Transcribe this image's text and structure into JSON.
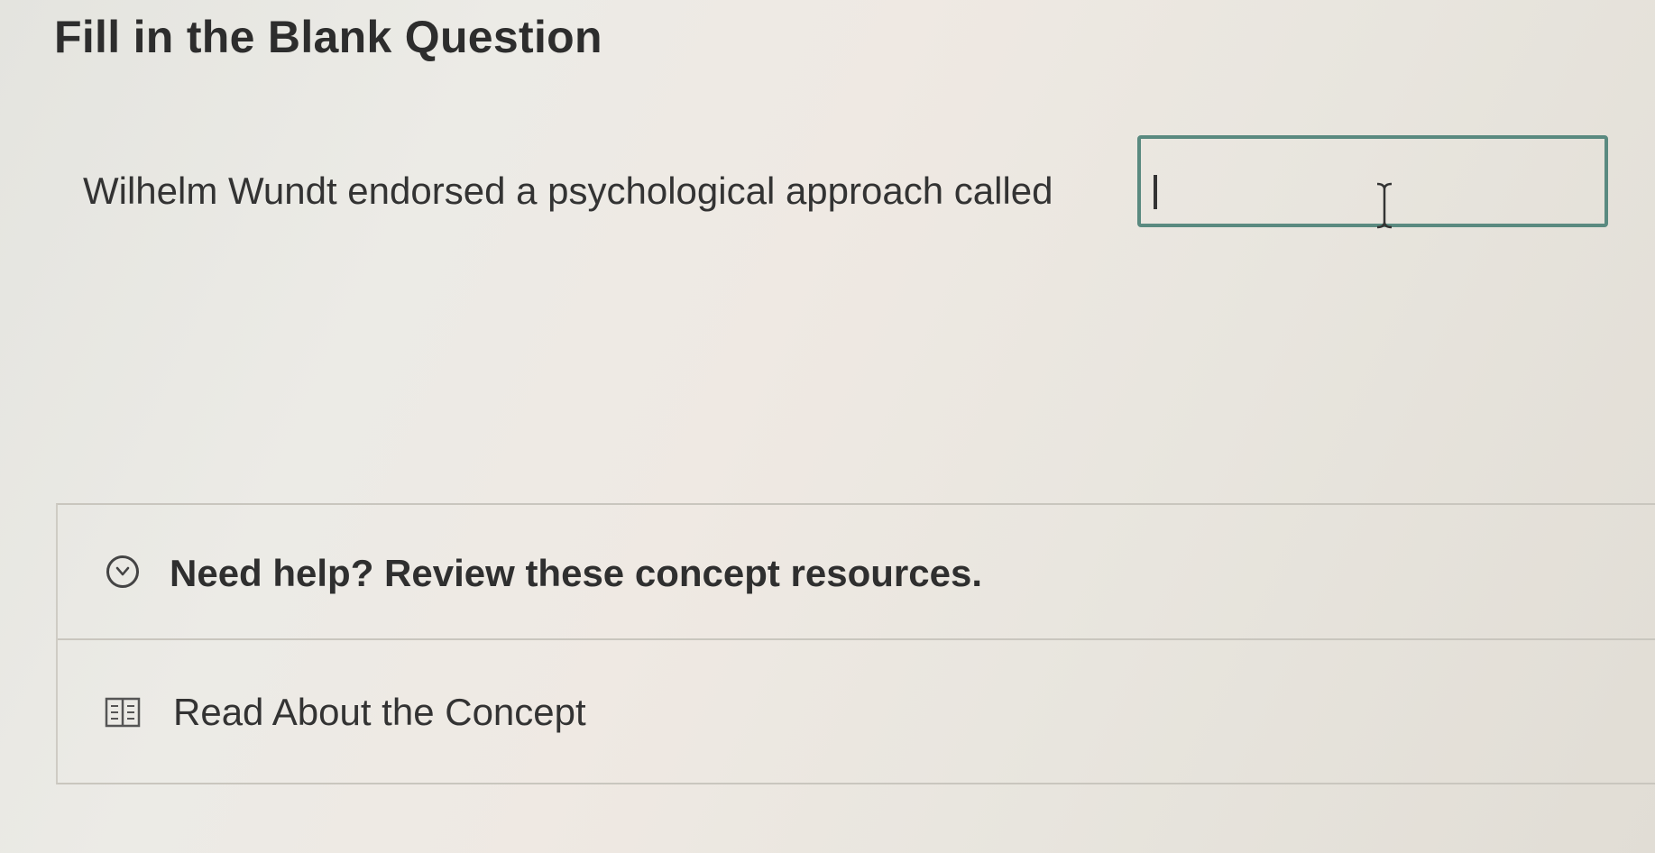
{
  "page": {
    "title": "Fill in the Blank Question"
  },
  "question": {
    "prompt": "Wilhelm Wundt endorsed a psychological approach called",
    "answer_value": "",
    "border_color": "#5a8a80"
  },
  "help": {
    "toggle_icon": "chevron-down-circle-icon",
    "label": "Need help? Review these concept resources.",
    "resources": [
      {
        "icon": "book-icon",
        "label": "Read About the Concept"
      }
    ]
  }
}
